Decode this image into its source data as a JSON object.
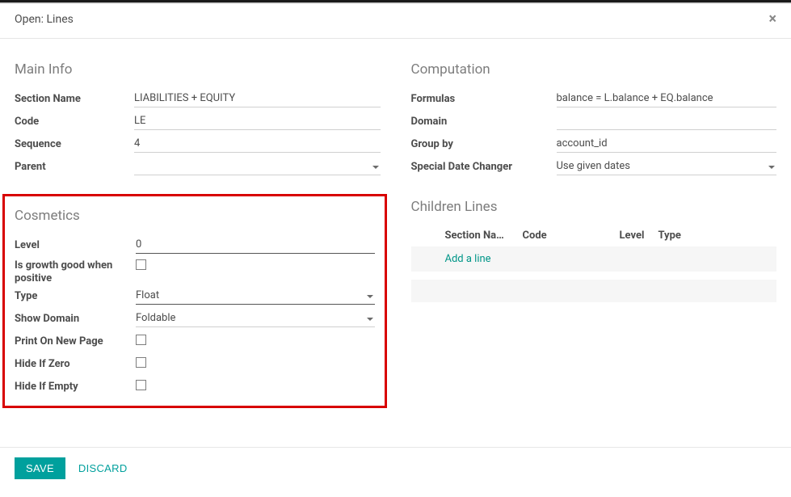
{
  "modal": {
    "title": "Open: Lines",
    "close_icon": "×"
  },
  "main_info": {
    "heading": "Main Info",
    "section_name_label": "Section Name",
    "section_name_value": "LIABILITIES + EQUITY",
    "code_label": "Code",
    "code_value": "LE",
    "sequence_label": "Sequence",
    "sequence_value": "4",
    "parent_label": "Parent",
    "parent_value": ""
  },
  "cosmetics": {
    "heading": "Cosmetics",
    "level_label": "Level",
    "level_value": "0",
    "growth_label": "Is growth good when positive",
    "type_label": "Type",
    "type_value": "Float",
    "show_domain_label": "Show Domain",
    "show_domain_value": "Foldable",
    "print_new_page_label": "Print On New Page",
    "hide_if_zero_label": "Hide If Zero",
    "hide_if_empty_label": "Hide If Empty"
  },
  "computation": {
    "heading": "Computation",
    "formulas_label": "Formulas",
    "formulas_value": "balance = L.balance + EQ.balance",
    "domain_label": "Domain",
    "domain_value": "",
    "group_by_label": "Group by",
    "group_by_value": "account_id",
    "special_date_label": "Special Date Changer",
    "special_date_value": "Use given dates"
  },
  "children": {
    "heading": "Children Lines",
    "col_section_name": "Section Na…",
    "col_code": "Code",
    "col_level": "Level",
    "col_type": "Type",
    "add_line": "Add a line"
  },
  "footer": {
    "save": "SAVE",
    "discard": "DISCARD"
  }
}
